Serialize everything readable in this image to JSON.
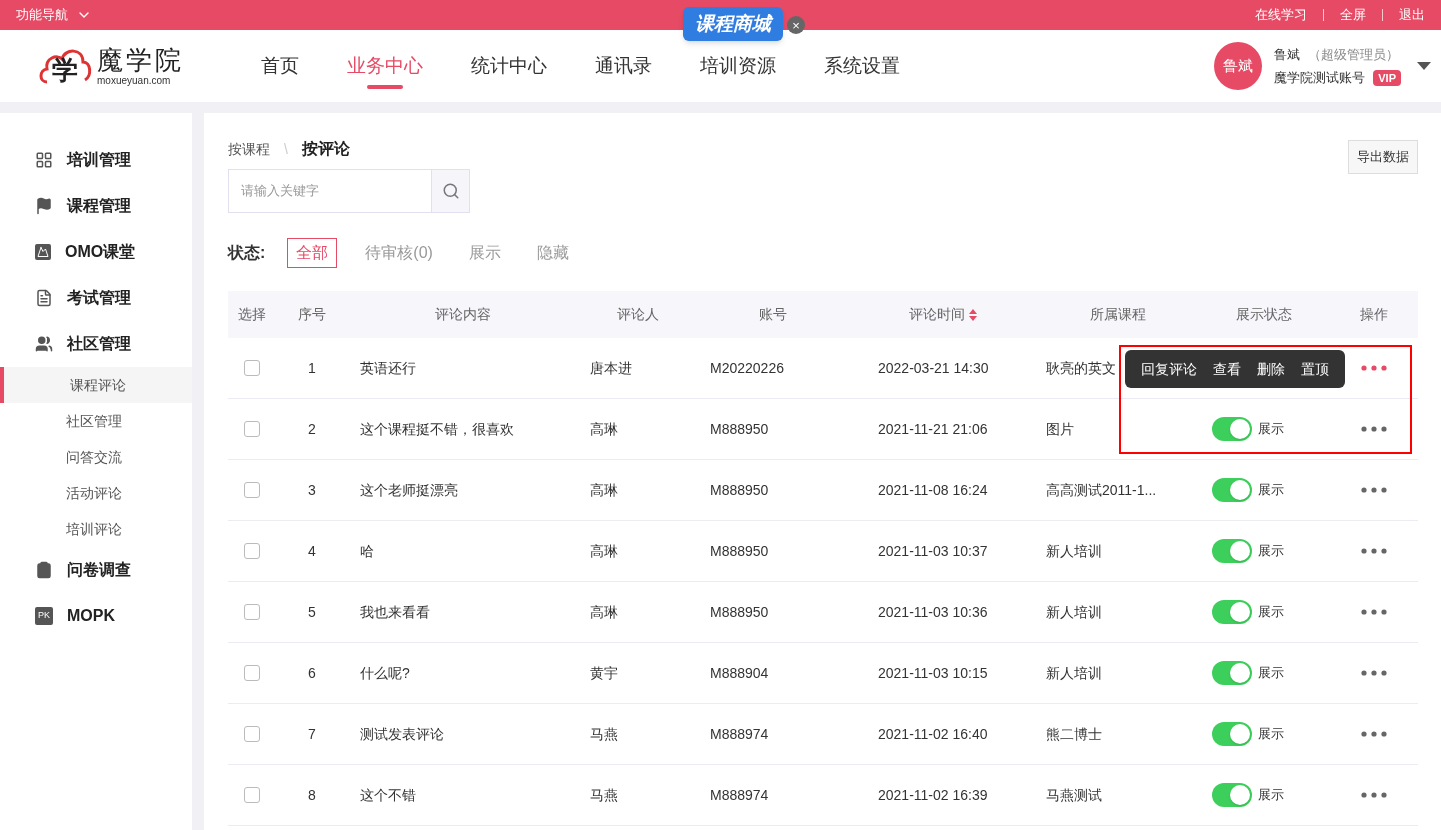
{
  "top_bar": {
    "menu": "功能导航",
    "links": [
      "在线学习",
      "全屏",
      "退出"
    ]
  },
  "promo": {
    "label": "课程商城",
    "close": "×"
  },
  "logo": {
    "mark": "学",
    "name": "魔学院",
    "domain": "moxueyuan.com"
  },
  "nav": [
    {
      "label": "首页",
      "selected": false
    },
    {
      "label": "业务中心",
      "selected": true
    },
    {
      "label": "统计中心",
      "selected": false
    },
    {
      "label": "通讯录",
      "selected": false
    },
    {
      "label": "培训资源",
      "selected": false
    },
    {
      "label": "系统设置",
      "selected": false
    }
  ],
  "user": {
    "avatar": "鲁斌",
    "name": "鲁斌",
    "role": "（超级管理员）",
    "account": "魔学院测试账号",
    "badge": "VIP"
  },
  "sidebar": {
    "items": [
      {
        "kind": "grid",
        "label": "培训管理"
      },
      {
        "kind": "flag",
        "label": "课程管理"
      },
      {
        "kind": "picture",
        "label": "OMO课堂"
      },
      {
        "kind": "doc",
        "label": "考试管理"
      },
      {
        "kind": "people",
        "label": "社区管理",
        "children": [
          {
            "label": "课程评论",
            "selected": true
          },
          {
            "label": "社区管理",
            "selected": false
          },
          {
            "label": "问答交流",
            "selected": false
          },
          {
            "label": "活动评论",
            "selected": false
          },
          {
            "label": "培训评论",
            "selected": false
          }
        ]
      },
      {
        "kind": "clipboard",
        "label": "问卷调查"
      },
      {
        "kind": "pk",
        "label": "MOPK",
        "icon_text": "PK"
      }
    ]
  },
  "breadcrumb": [
    {
      "label": "按课程",
      "selected": false
    },
    {
      "label": "按评论",
      "selected": true
    }
  ],
  "separator": "\\",
  "export_button": "导出数据",
  "search": {
    "placeholder": "请输入关键字"
  },
  "status_filter": {
    "label": "状态:",
    "options": [
      {
        "label": "全部",
        "selected": true
      },
      {
        "label": "待审核(0)",
        "selected": false
      },
      {
        "label": "展示",
        "selected": false
      },
      {
        "label": "隐藏",
        "selected": false
      }
    ]
  },
  "table": {
    "columns": [
      "选择",
      "序号",
      "评论内容",
      "评论人",
      "账号",
      "评论时间",
      "所属课程",
      "展示状态",
      "操作"
    ],
    "rows": [
      {
        "checked": false,
        "no": "1",
        "content": "英语还行",
        "person": "唐本进",
        "account": "M20220226",
        "time": "2022-03-21 14:30",
        "course": "耿亮的英文",
        "menu_open": true
      },
      {
        "checked": false,
        "no": "2",
        "content": "这个课程挺不错，很喜欢",
        "person": "高琳",
        "account": "M888950",
        "time": "2021-11-21 21:06",
        "course": "图片",
        "menu_open": false,
        "on": true,
        "status": "展示"
      },
      {
        "checked": false,
        "no": "3",
        "content": "这个老师挺漂亮",
        "person": "高琳",
        "account": "M888950",
        "time": "2021-11-08 16:24",
        "course": "高高测试2011-1...",
        "menu_open": false,
        "on": true,
        "status": "展示"
      },
      {
        "checked": false,
        "no": "4",
        "content": "哈",
        "person": "高琳",
        "account": "M888950",
        "time": "2021-11-03 10:37",
        "course": "新人培训",
        "menu_open": false,
        "on": true,
        "status": "展示"
      },
      {
        "checked": false,
        "no": "5",
        "content": "我也来看看",
        "person": "高琳",
        "account": "M888950",
        "time": "2021-11-03 10:36",
        "course": "新人培训",
        "menu_open": false,
        "on": true,
        "status": "展示"
      },
      {
        "checked": false,
        "no": "6",
        "content": "什么呢?",
        "person": "黄宇",
        "account": "M888904",
        "time": "2021-11-03 10:15",
        "course": "新人培训",
        "menu_open": false,
        "on": true,
        "status": "展示"
      },
      {
        "checked": false,
        "no": "7",
        "content": "测试发表评论",
        "person": "马燕",
        "account": "M888974",
        "time": "2021-11-02 16:40",
        "course": "熊二博士",
        "menu_open": false,
        "on": true,
        "status": "展示"
      },
      {
        "checked": false,
        "no": "8",
        "content": "这个不错",
        "person": "马燕",
        "account": "M888974",
        "time": "2021-11-02 16:39",
        "course": "马燕测试",
        "menu_open": false,
        "on": true,
        "status": "展示"
      }
    ]
  },
  "action_menu": {
    "actions": [
      "回复评论",
      "查看",
      "删除",
      "置顶"
    ]
  }
}
